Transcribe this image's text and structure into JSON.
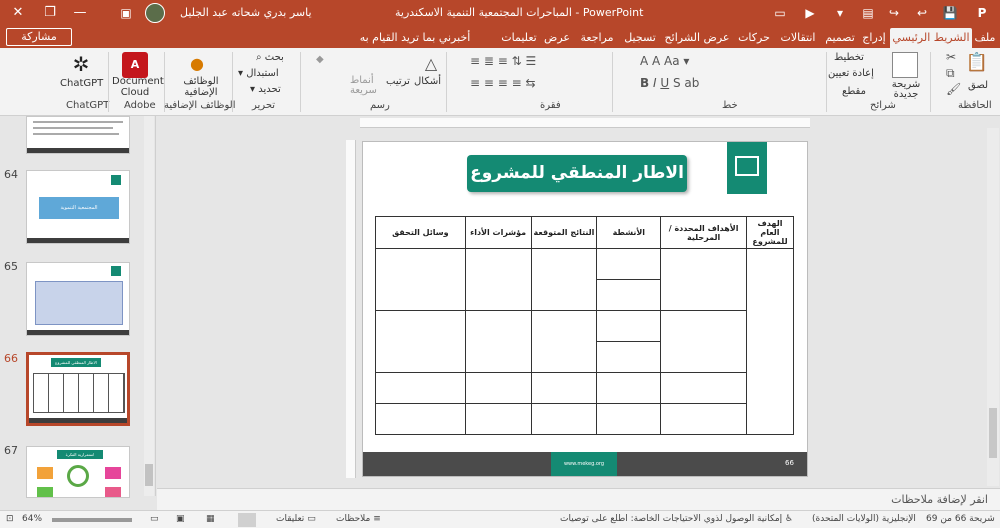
{
  "titlebar": {
    "doc_title": "المباحرات المجتمعية التنمية الاسكندرية - PowerPoint",
    "user_name": "ياسر بدري شحاته عبد الجليل",
    "minimize": "—",
    "restore": "❐",
    "close": "✕"
  },
  "tabs": {
    "file": "ملف",
    "home": "الشريط الرئيسي",
    "insert": "إدراج",
    "design": "تصميم",
    "transitions": "انتقالات",
    "animations": "حركات",
    "slideshow": "عرض الشرائح",
    "record": "تسجيل",
    "review": "مراجعة",
    "view": "عرض",
    "help": "تعليمات",
    "tellme": "أخبرني بما تريد القيام به",
    "share": "مشاركة"
  },
  "ribbon": {
    "clipboard": {
      "label": "الحافظة",
      "paste": "لصق"
    },
    "slides": {
      "label": "شرائح",
      "new_slide": "شريحة جديدة",
      "layout": "تخطيط",
      "reset": "إعادة تعيين",
      "section": "مقطع"
    },
    "font": {
      "label": "خط"
    },
    "paragraph": {
      "label": "فقرة"
    },
    "drawing": {
      "label": "رسم",
      "shapes": "أشكال",
      "arrange": "ترتيب",
      "quick_styles": "أنماط سريعة"
    },
    "editing": {
      "label": "تحرير",
      "find": "بحث",
      "replace": "استبدال",
      "select": "تحديد"
    },
    "addins": {
      "label": "الوظائف الإضافية",
      "addins_btn": "الوظائف الإضافية"
    },
    "adobe": {
      "label": "Adobe",
      "btn": "Document Cloud"
    },
    "chatgpt": {
      "label": "ChatGPT",
      "btn": "ChatGPT"
    }
  },
  "slides_panel": {
    "numbers": [
      "64",
      "65",
      "66",
      "67"
    ],
    "thumb64_text": "المجتمعية التنموية",
    "thumb66_text": "الاطار المنطقي للمشروع",
    "thumb67_text": "استمرارية الفكرة"
  },
  "slide": {
    "title": "الاطار المنطقي للمشروع",
    "footer_site": "www.mekeg.org",
    "page_num": "66",
    "table_headers": [
      "الهدف العام للمشروع",
      "الأهداف المحددة / المرحلية",
      "الأنشطة",
      "النتائج المتوقعة",
      "مؤشرات الأداء",
      "وسائل التحقق"
    ]
  },
  "notes": {
    "placeholder": "انقر لإضافة ملاحظات"
  },
  "status": {
    "slide_counter": "شريحة 66 من 69",
    "language": "الإنجليزية (الولايات المتحدة)",
    "accessibility": "إمكانية الوصول لذوي الاحتياجات الخاصة: اطلع على توصيات",
    "notes_btn": "ملاحظات",
    "comments_btn": "تعليقات",
    "zoom": "64%"
  },
  "colors": {
    "accent": "#b7472a",
    "slide_green": "#148a73"
  }
}
